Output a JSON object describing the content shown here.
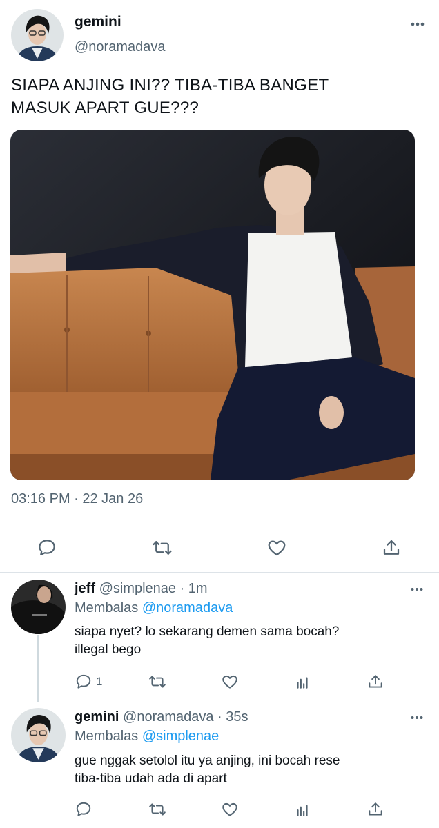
{
  "main_tweet": {
    "display_name": "gemini",
    "handle": "@noramadava",
    "text_line1": "SIAPA ANJING INI?? TIBA-TIBA BANGET",
    "text_line2": "MASUK APART GUE???",
    "timestamp": "03:16 PM · 22 Jan 26",
    "actions": [
      "comment-icon",
      "retweet-icon",
      "heart-icon",
      "share-icon"
    ]
  },
  "replies": [
    {
      "display_name": "jeff",
      "handle_time": "@simplenae · 1m",
      "replying_label": "Membalas",
      "replying_to": "@noramadava",
      "text_line1": "siapa nyet? lo sekarang demen sama bocah?",
      "text_line2": "illegal bego",
      "reply_count": "1"
    },
    {
      "display_name": "gemini",
      "handle_time": "@noramadava · 35s",
      "replying_label": "Membalas",
      "replying_to": "@simplenae",
      "text_line1": "gue nggak setolol itu ya anjing, ini bocah rese",
      "text_line2": "tiba-tiba udah ada di apart",
      "reply_count": ""
    }
  ],
  "colors": {
    "text": "#0f1419",
    "secondary": "#536471",
    "link": "#1d9bf0",
    "divider": "#dde3e8",
    "sofa": "#b9733f"
  }
}
